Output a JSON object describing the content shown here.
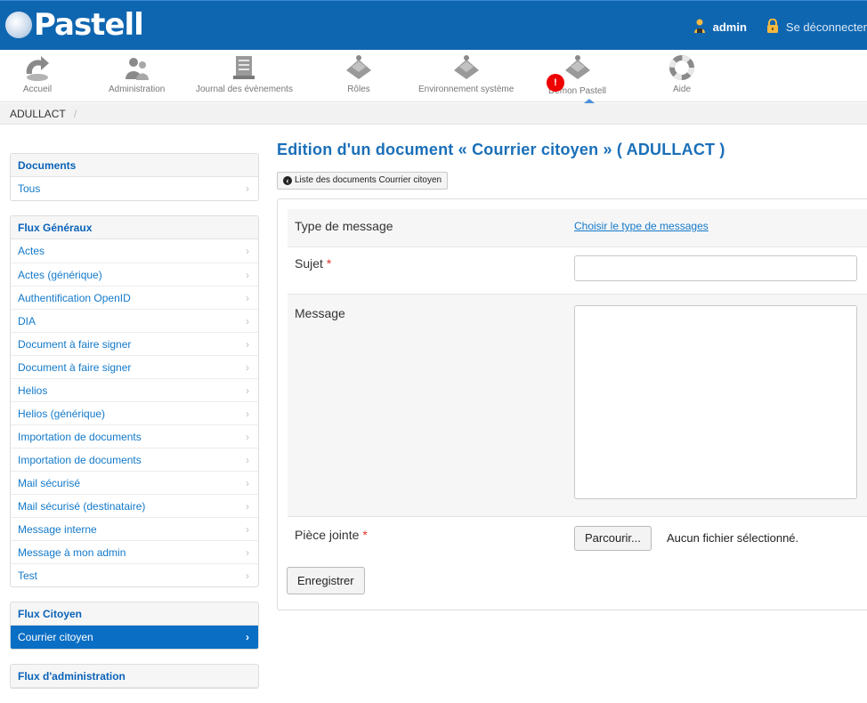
{
  "header": {
    "logo_text": "Pastell",
    "user_name": "admin",
    "logout_label": "Se déconnecter"
  },
  "toolbar": {
    "items": [
      {
        "label": "Accueil",
        "icon": "home-icon"
      },
      {
        "label": "Administration",
        "icon": "users-icon"
      },
      {
        "label": "Journal des évènements",
        "icon": "journal-icon"
      },
      {
        "label": "Rôles",
        "icon": "puzzle-icon"
      },
      {
        "label": "Environnement système",
        "icon": "puzzle-icon"
      },
      {
        "label": "Démon Pastell",
        "icon": "puzzle-icon",
        "badge": "!"
      },
      {
        "label": "Aide",
        "icon": "lifebuoy-icon"
      }
    ]
  },
  "breadcrumb": {
    "entity": "ADULLACT",
    "separator": "/"
  },
  "sidebar": {
    "documents": {
      "title": "Documents",
      "items": [
        "Tous"
      ]
    },
    "flux_generaux": {
      "title": "Flux Généraux",
      "items": [
        "Actes",
        "Actes (générique)",
        "Authentification OpenID",
        "DIA",
        "Document à faire signer",
        "Document à faire signer",
        "Helios",
        "Helios (générique)",
        "Importation de documents",
        "Importation de documents",
        "Mail sécurisé",
        "Mail sécurisé (destinataire)",
        "Message interne",
        "Message à mon admin",
        "Test"
      ]
    },
    "flux_citoyen": {
      "title": "Flux Citoyen",
      "items": [
        "Courrier citoyen"
      ],
      "active_index": 0
    },
    "flux_admin": {
      "title": "Flux d'administration"
    },
    "chevron": "›"
  },
  "main": {
    "title": "Edition d'un document « Courrier citoyen » ( ADULLACT )",
    "back_button": "Liste des documents Courrier citoyen",
    "form": {
      "type_label": "Type de message",
      "type_link": "Choisir le type de messages",
      "subject_label": "Sujet",
      "subject_value": "",
      "message_label": "Message",
      "message_value": "",
      "attachment_label": "Pièce jointe",
      "browse_button": "Parcourir...",
      "no_file_text": "Aucun fichier sélectionné.",
      "required_mark": "*",
      "save_button": "Enregistrer"
    }
  },
  "colors": {
    "header_bg": "#0f66b0",
    "link": "#1479c9",
    "active_item": "#0a6ec4",
    "required": "#dd3333",
    "badge": "#ee0000"
  }
}
